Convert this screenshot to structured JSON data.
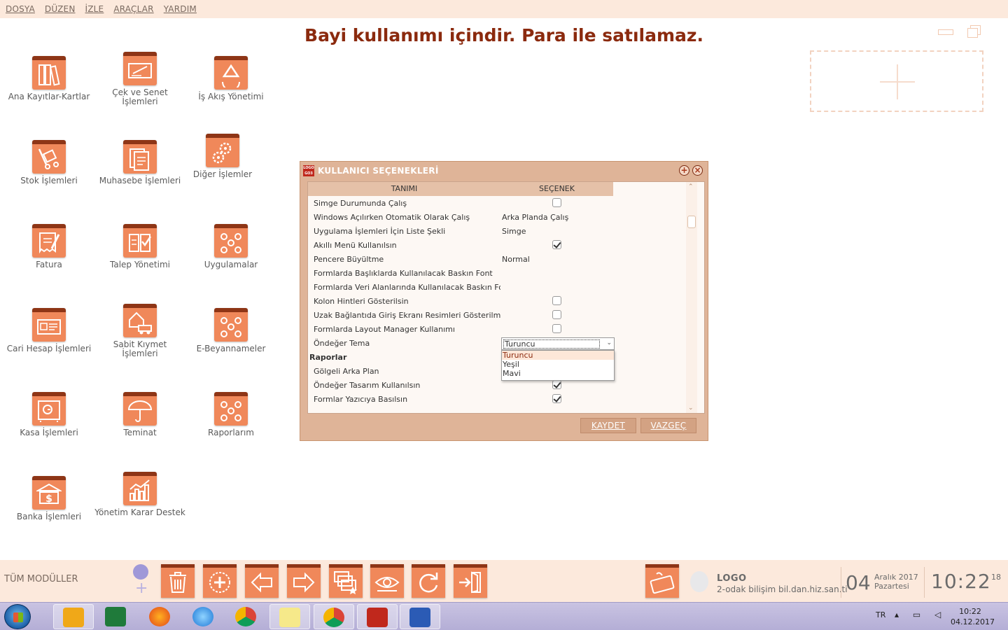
{
  "menu": [
    "DOSYA",
    "DÜZEN",
    "İZLE",
    "ARAÇLAR",
    "YARDIM"
  ],
  "banner": "Bayi kullanımı içindir. Para ile satılamaz.",
  "modules": [
    {
      "label": "Ana Kayıtlar-Kartlar",
      "icon": "binders-icon"
    },
    {
      "label": "Çek ve Senet İşlemleri",
      "icon": "cheque-icon"
    },
    {
      "label": "İş Akış Yönetimi",
      "icon": "recycle-icon"
    },
    {
      "label": "Stok İşlemleri",
      "icon": "hand-truck-icon"
    },
    {
      "label": "Muhasebe İşlemleri",
      "icon": "ledger-icon"
    },
    {
      "label": "Diğer İşlemler",
      "icon": "gears-icon"
    },
    {
      "label": "Fatura",
      "icon": "invoice-icon"
    },
    {
      "label": "Talep Yönetimi",
      "icon": "checklist-icon"
    },
    {
      "label": "Uygulamalar",
      "icon": "apps-icon"
    },
    {
      "label": "Cari Hesap İşlemleri",
      "icon": "id-card-icon"
    },
    {
      "label": "Sabit Kıymet İşlemleri",
      "icon": "house-car-icon"
    },
    {
      "label": "E-Beyannameler",
      "icon": "apps-icon"
    },
    {
      "label": "Kasa İşlemleri",
      "icon": "safe-icon"
    },
    {
      "label": "Teminat",
      "icon": "umbrella-icon"
    },
    {
      "label": "Raporlarım",
      "icon": "apps-icon"
    },
    {
      "label": "Banka İşlemleri",
      "icon": "bank-icon"
    },
    {
      "label": "Yönetim Karar Destek",
      "icon": "bar-chart-icon"
    }
  ],
  "dialog": {
    "title": "KULLANICI SEÇENEKLERİ",
    "columns": [
      "TANIMI",
      "SEÇENEK"
    ],
    "rows": [
      {
        "label": "Simge Durumunda Çalış",
        "value": "",
        "check": "unchecked"
      },
      {
        "label": "Windows Açılırken Otomatik Olarak Çalış",
        "value": "Arka Planda Çalış",
        "check": "none"
      },
      {
        "label": "Uygulama İşlemleri İçin Liste Şekli",
        "value": "Simge",
        "check": "none"
      },
      {
        "label": "Akıllı Menü Kullanılsın",
        "value": "",
        "check": "checked"
      },
      {
        "label": "Pencere Büyültme",
        "value": "Normal",
        "check": "none"
      },
      {
        "label": "Formlarda Başlıklarda Kullanılacak Baskın Font",
        "value": "",
        "check": "none"
      },
      {
        "label": "Formlarda Veri Alanlarında Kullanılacak Baskın Font",
        "value": "",
        "check": "none"
      },
      {
        "label": "Kolon Hintleri Gösterilsin",
        "value": "",
        "check": "unchecked"
      },
      {
        "label": "Uzak Bağlantıda Giriş Ekranı Resimleri Gösterilmesin",
        "value": "",
        "check": "unchecked"
      },
      {
        "label": "Formlarda Layout Manager Kullanımı",
        "value": "",
        "check": "unchecked"
      },
      {
        "label": "Öndeğer Tema",
        "value": "",
        "check": "none"
      },
      {
        "label": "Raporlar",
        "value": "",
        "check": "none",
        "group": true
      },
      {
        "label": "Gölgeli Arka Plan",
        "value": "",
        "check": "none"
      },
      {
        "label": "Öndeğer Tasarım Kullanılsın",
        "value": "",
        "check": "checked"
      },
      {
        "label": "Formlar Yazıcıya Basılsın",
        "value": "",
        "check": "checked"
      }
    ],
    "theme_combo": {
      "value": "Turuncu",
      "options": [
        "Turuncu",
        "Yeşil",
        "Mavi"
      ]
    },
    "save_label": "KAYDET",
    "cancel_label": "VAZGEÇ"
  },
  "bottom": {
    "all_modules": "TÜM MODÜLLER",
    "tools": [
      "trash-icon",
      "add-dashed-icon",
      "back-arrow-icon",
      "forward-arrow-icon",
      "windows-star-icon",
      "eye-icon",
      "refresh-icon",
      "exit-door-icon"
    ],
    "keyboard_icon": "keyboard-icon",
    "company": "LOGO",
    "company_detail": "2-odak bilişim bil.dan.hiz.san.ti",
    "day": "04",
    "month_year": "Aralık 2017",
    "weekday": "Pazartesi",
    "time": "10:22",
    "seconds": "18"
  },
  "taskbar": {
    "apps": [
      "outlook-icon",
      "excel-icon",
      "firefox-icon",
      "ie-icon",
      "chrome-icon",
      "sticky-notes-icon",
      "chrome-user-icon",
      "logo-go3-icon",
      "word-icon"
    ],
    "lang": "TR",
    "time": "10:22",
    "date": "04.12.2017"
  },
  "colors": {
    "accent": "#f0885a",
    "dark": "#8e3516",
    "banner": "#8b2a0e",
    "panel": "#fce9dc"
  }
}
